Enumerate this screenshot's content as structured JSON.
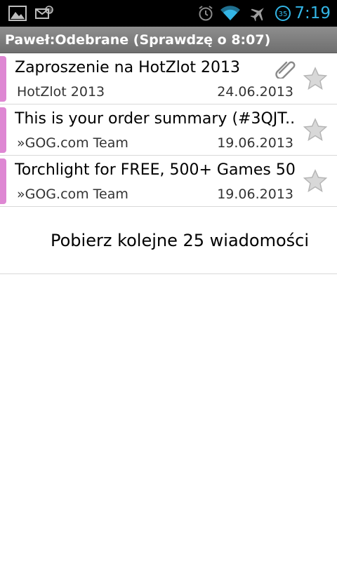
{
  "status_bar": {
    "time": "7:19",
    "battery_level": "35",
    "time_color": "#33b5e5",
    "left_icons": [
      "picture-icon",
      "mail-sync-icon"
    ],
    "right_icons": [
      "alarm-icon",
      "wifi-icon",
      "airplane-icon",
      "battery-icon"
    ]
  },
  "title_bar": {
    "title": "Paweł:Odebrane (Sprawdzę o 8:07)"
  },
  "messages": [
    {
      "subject": "Zaproszenie na HotZlot 2013",
      "sender": "HotZlot 2013",
      "date": "24.06.2013",
      "has_attachment": true,
      "starred": false,
      "chip_color": "#de87d3"
    },
    {
      "subject": "This is your order summary (#3QJT..",
      "sender": "»GOG.com Team",
      "date": "19.06.2013",
      "has_attachment": false,
      "starred": false,
      "chip_color": "#de87d3"
    },
    {
      "subject": "Torchlight for FREE, 500+ Games 50..",
      "sender": "»GOG.com Team",
      "date": "19.06.2013",
      "has_attachment": false,
      "starred": false,
      "chip_color": "#de87d3"
    }
  ],
  "load_more": {
    "label": "Pobierz kolejne 25 wiadomości"
  }
}
